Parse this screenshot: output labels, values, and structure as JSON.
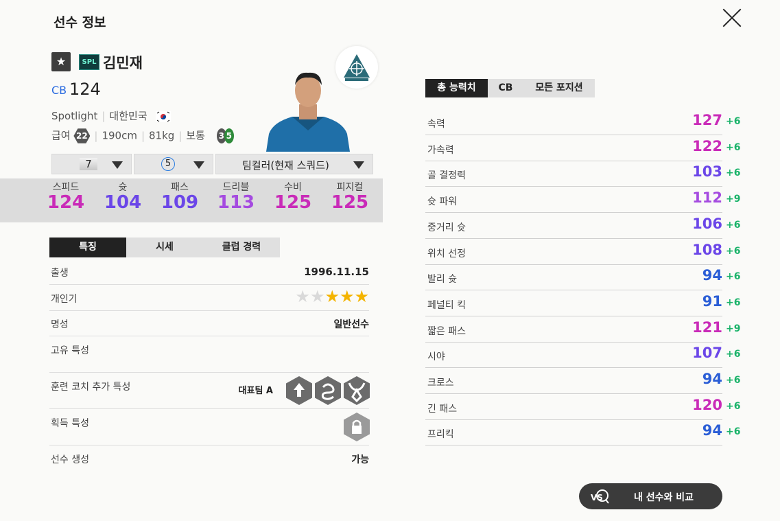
{
  "header": {
    "title": "선수 정보"
  },
  "player": {
    "name": "김민재",
    "season_badge": "SPL",
    "position": "CB",
    "ovr": "124",
    "season_name": "Spotlight",
    "nation": "대한민국",
    "salary_label": "급여",
    "salary": "22",
    "height": "190cm",
    "weight": "81kg",
    "body_type": "보통",
    "left_foot": "3",
    "right_foot": "5"
  },
  "selectors": {
    "enhance": "7",
    "grade": "5",
    "teamcolor": "팀컬러(현재 스쿼드)"
  },
  "summary_stats": [
    {
      "label": "스피드",
      "value": "124",
      "color": "#c92bb8"
    },
    {
      "label": "슛",
      "value": "104",
      "color": "#6b46e8"
    },
    {
      "label": "패스",
      "value": "109",
      "color": "#6b46e8"
    },
    {
      "label": "드리블",
      "value": "113",
      "color": "#a54be0"
    },
    {
      "label": "수비",
      "value": "125",
      "color": "#c92bb8"
    },
    {
      "label": "피지컬",
      "value": "125",
      "color": "#c92bb8"
    }
  ],
  "left_tabs": [
    "특징",
    "시세",
    "클럽 경력"
  ],
  "features": {
    "birth_label": "출생",
    "birth": "1996.11.15",
    "popularity_label": "개인기",
    "popularity_stars": 3,
    "popularity_max": 5,
    "reputation_label": "명성",
    "reputation": "일반선수",
    "unique_label": "고유 특성",
    "coach_label": "훈련 코치 추가 특성",
    "coach_value": "대표팀 A",
    "acquired_label": "획득 특성",
    "create_label": "선수 생성",
    "create_value": "가능"
  },
  "right_tabs": [
    "총 능력치",
    "CB",
    "모든 포지션"
  ],
  "detail_stats": [
    {
      "label": "속력",
      "value": "127",
      "bonus": "+6",
      "color": "#c92bb8"
    },
    {
      "label": "가속력",
      "value": "122",
      "bonus": "+6",
      "color": "#c92bb8"
    },
    {
      "label": "골 결정력",
      "value": "103",
      "bonus": "+6",
      "color": "#6b46e8"
    },
    {
      "label": "슛 파워",
      "value": "112",
      "bonus": "+9",
      "color": "#a54be0"
    },
    {
      "label": "중거리 슛",
      "value": "106",
      "bonus": "+6",
      "color": "#6b46e8"
    },
    {
      "label": "위치 선정",
      "value": "108",
      "bonus": "+6",
      "color": "#6b46e8"
    },
    {
      "label": "발리 슛",
      "value": "94",
      "bonus": "+6",
      "color": "#2b5ed6"
    },
    {
      "label": "페널티 킥",
      "value": "91",
      "bonus": "+6",
      "color": "#2b5ed6"
    },
    {
      "label": "짧은 패스",
      "value": "121",
      "bonus": "+9",
      "color": "#c92bb8"
    },
    {
      "label": "시야",
      "value": "107",
      "bonus": "+6",
      "color": "#6b46e8"
    },
    {
      "label": "크로스",
      "value": "94",
      "bonus": "+6",
      "color": "#2b5ed6"
    },
    {
      "label": "긴 패스",
      "value": "120",
      "bonus": "+6",
      "color": "#c92bb8"
    },
    {
      "label": "프리킥",
      "value": "94",
      "bonus": "+6",
      "color": "#2b5ed6"
    }
  ],
  "compare_button": "내 선수와 비교"
}
